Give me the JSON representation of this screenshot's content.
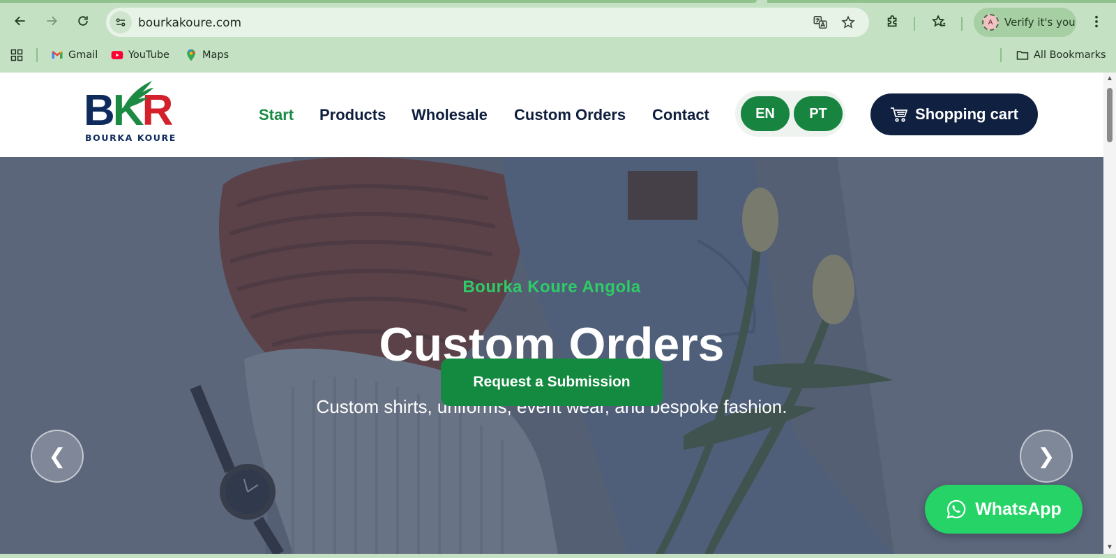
{
  "browser": {
    "url": "bourkakoure.com",
    "verify_label": "Verify it's you",
    "avatar_letter": "A",
    "bookmarks": [
      {
        "label": "Gmail",
        "icon": "gmail-icon"
      },
      {
        "label": "YouTube",
        "icon": "youtube-icon"
      },
      {
        "label": "Maps",
        "icon": "maps-icon"
      }
    ],
    "all_bookmarks_label": "All Bookmarks"
  },
  "site": {
    "logo": {
      "mark_b": "B",
      "mark_k": "K",
      "mark_r": "R",
      "subtitle": "BOURKA KOURE"
    },
    "nav": [
      {
        "label": "Start",
        "active": true
      },
      {
        "label": "Products",
        "active": false
      },
      {
        "label": "Wholesale",
        "active": false
      },
      {
        "label": "Custom Orders",
        "active": false
      },
      {
        "label": "Contact",
        "active": false
      }
    ],
    "languages": [
      "EN",
      "PT"
    ],
    "cart_label": "Shopping cart",
    "colors": {
      "brand_green": "#17853f",
      "navy": "#102040",
      "accent_green": "#2ecc66",
      "whatsapp": "#25d366"
    }
  },
  "hero": {
    "kicker": "Bourka Koure Angola",
    "title": "Custom Orders",
    "subtitle": "Custom shirts, uniforms, event wear, and bespoke fashion.",
    "cta": "Request a Submission",
    "prev": "❮",
    "next": "❯"
  },
  "whatsapp_label": "WhatsApp"
}
